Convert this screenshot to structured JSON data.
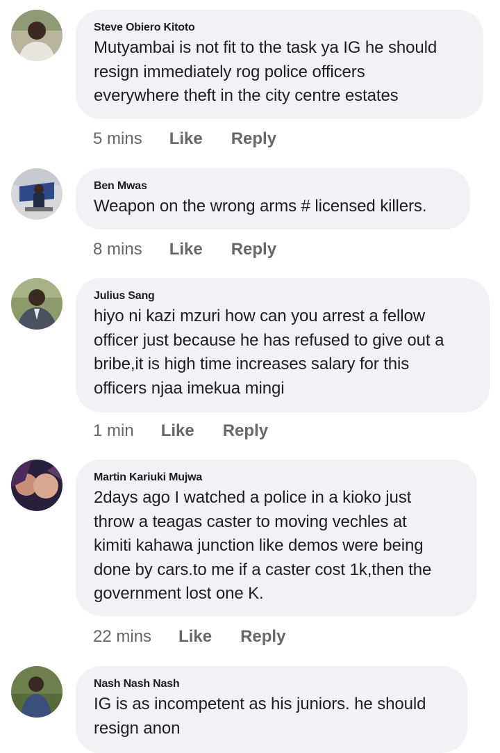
{
  "colors": {
    "bubble": "#f0f2f5",
    "text": "#1c1e21",
    "muted": "#65676b"
  },
  "comments": [
    {
      "author": "Steve Obiero Kitoto",
      "text": "Mutyambai is not fit to the task ya IG he should\nresign immediately rog police officers\neverywhere theft in the city centre estates",
      "time": "5 mins",
      "like_label": "Like",
      "reply_label": "Reply",
      "avatar_icon": "user-avatar-photo"
    },
    {
      "author": "Ben Mwas",
      "text": "Weapon on the wrong arms # licensed killers.",
      "time": "8 mins",
      "like_label": "Like",
      "reply_label": "Reply",
      "avatar_icon": "user-avatar-photo"
    },
    {
      "author": "Julius Sang",
      "text": "hiyo ni kazi  mzuri how can you arrest a fellow\nofficer just because he has refused to give out a\nbribe,it is high time increases salary for this\nofficers njaa imekua mingi",
      "time": "1 min",
      "like_label": "Like",
      "reply_label": "Reply",
      "avatar_icon": "user-avatar-photo"
    },
    {
      "author": "Martin Kariuki Mujwa",
      "text": "2days ago I watched a police in a kioko just\nthrow a teagas caster to moving vechles at\nkimiti kahawa junction like demos were being\ndone by cars.to me if a caster cost 1k,then the\ngovernment lost one K.",
      "time": "22 mins",
      "like_label": "Like",
      "reply_label": "Reply",
      "avatar_icon": "user-avatar-photo"
    },
    {
      "author": "Nash Nash Nash",
      "text": "IG is as incompetent as his juniors. he should\nresign anon",
      "time": "",
      "like_label": "",
      "reply_label": "",
      "avatar_icon": "user-avatar-photo"
    }
  ]
}
